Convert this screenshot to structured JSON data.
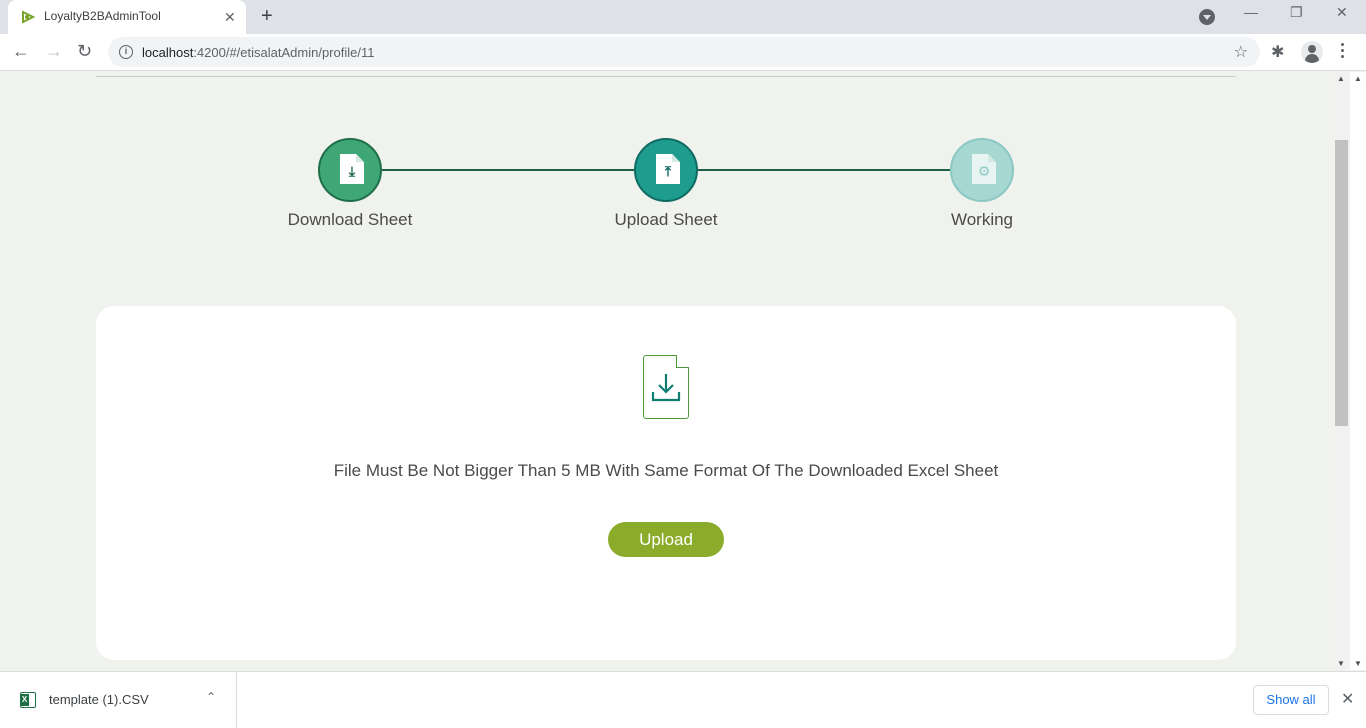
{
  "browser": {
    "tab_title": "LoyaltyB2BAdminTool",
    "tab_close": "✕",
    "new_tab": "+",
    "url_host": "localhost",
    "url_path": ":4200/#/etisalatAdmin/profile/11",
    "window_minimize": "—",
    "window_restore": "❐",
    "window_close": "✕",
    "back": "←",
    "forward": "→",
    "reload": "↻",
    "info": "i",
    "bookmark": "☆",
    "extensions": "✱"
  },
  "stepper": {
    "steps": [
      {
        "label": "Download Sheet",
        "icon": "download-doc-icon",
        "color": "#3fa675",
        "border": "#1f6e4a",
        "glyph": "⤓"
      },
      {
        "label": "Upload Sheet",
        "icon": "upload-doc-icon",
        "color": "#1e9c8e",
        "border": "#0f6a62",
        "glyph": "⤒"
      },
      {
        "label": "Working",
        "icon": "gear-doc-icon",
        "color": "#a6d7d2",
        "border": "#8cc8c2",
        "glyph": "⚙"
      }
    ],
    "line_color": "#1f5e4a"
  },
  "upload_card": {
    "icon": "download-file-icon",
    "glyph": "⤓",
    "note": "File Must Be Not Bigger Than 5 MB With Same Format Of The Downloaded Excel Sheet",
    "button_label": "Upload",
    "button_color": "#8aac2a"
  },
  "download_shelf": {
    "file_name": "template (1).CSV",
    "chevron": "⌃",
    "show_all": "Show all",
    "close": "✕"
  }
}
